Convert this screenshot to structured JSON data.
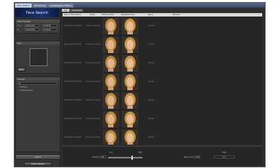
{
  "window": {
    "tabs": [
      {
        "label": "Face Search",
        "active": true
      },
      {
        "label": "Monitoring",
        "active": false
      },
      {
        "label": "Investigation History",
        "active": false
      }
    ]
  },
  "sidebar": {
    "banner_title": "Face Search",
    "time_panel": {
      "title": "Search Range",
      "from_label": "From",
      "to_label": "To",
      "from_date": "2016/01/01",
      "from_time": "00:00:00",
      "to_date": "2016/01/01",
      "to_time": "23:59:59"
    },
    "face_panel": {
      "title": "Face",
      "open_button": "Open"
    },
    "camera_panel": {
      "title": "Camera",
      "select_value": "All",
      "items": [
        "Camera",
        "Camera Group"
      ]
    },
    "search_button": "Search",
    "bottom_button": "Export Results"
  },
  "main": {
    "tabs": [
      {
        "label": "List",
        "active": true
      },
      {
        "label": "Thumbnail",
        "active": false
      }
    ],
    "columns": [
      "Date & Time Stamp",
      "Place",
      "Matching Face",
      "Registered Face",
      "Name",
      "Remarks"
    ],
    "rows": [
      {
        "datetime": "2016/01/01 12:00:01",
        "place": "Entrance Camera",
        "name": "Jennifer"
      },
      {
        "datetime": "2016/01/01 12:00:02",
        "place": "Entrance Camera",
        "name": "Jennifer"
      },
      {
        "datetime": "2016/01/01 12:00:03",
        "place": "Entrance Camera",
        "name": "Jennifer"
      },
      {
        "datetime": "2016/01/01 12:00:04",
        "place": "Entrance Camera",
        "name": "Jennifer"
      },
      {
        "datetime": "2016/01/01 12:00:05",
        "place": "Entrance Camera",
        "name": "Jennifer"
      },
      {
        "datetime": "2016/01/01 12:00:06",
        "place": "Entrance Camera",
        "name": "Jennifer"
      },
      {
        "datetime": "2016/01/01 12:00:07",
        "place": "Entrance Camera",
        "name": "Jennifer"
      }
    ],
    "bottom": {
      "similarity_label": "Similarity",
      "similarity_value": "80",
      "slider_level": 0.7,
      "low_label": "Low",
      "high_label": "High",
      "result_label": "Result Count",
      "result_value": "100",
      "page_label": "Page",
      "page_value": "1 / 1"
    }
  }
}
